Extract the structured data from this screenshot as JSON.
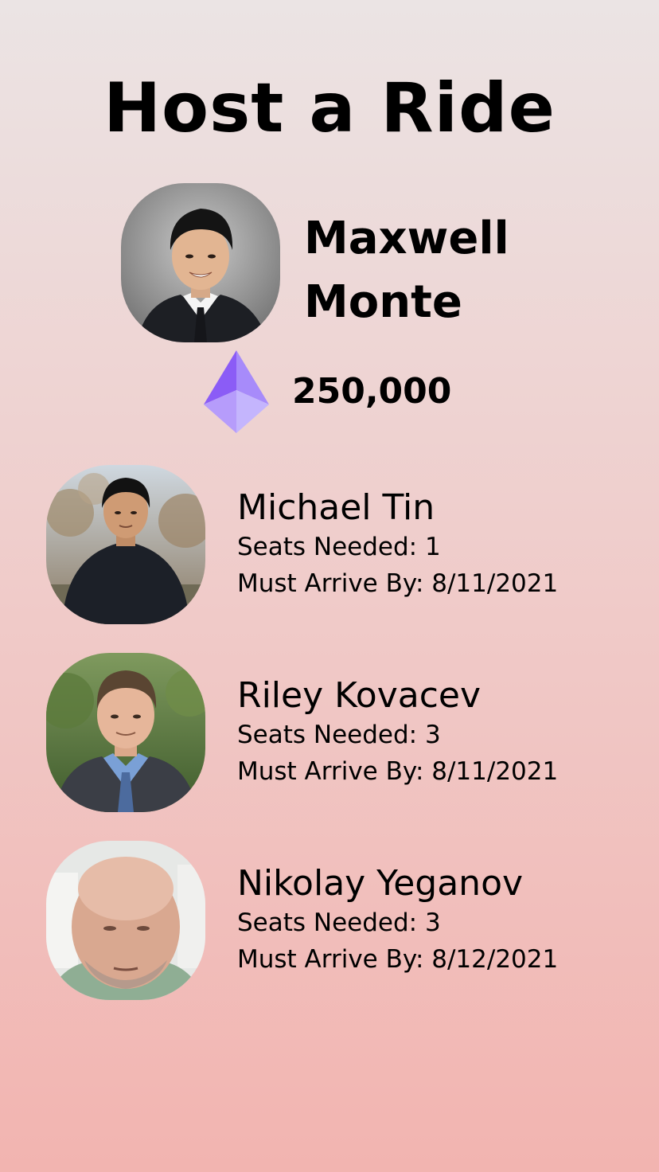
{
  "header": {
    "title": "Host a Ride"
  },
  "host": {
    "first_name": "Maxwell",
    "last_name": "Monte",
    "balance": "250,000",
    "token_icon": "ethereum-diamond-icon",
    "token_colors": [
      "#8b5cf6",
      "#a78bfa",
      "#c4b5fd"
    ]
  },
  "labels": {
    "seats": "Seats Needed:",
    "arrive": "Must Arrive By:"
  },
  "riders": [
    {
      "name": "Michael Tin",
      "seats": "1",
      "arrive": "8/11/2021"
    },
    {
      "name": "Riley Kovacev",
      "seats": "3",
      "arrive": "8/11/2021"
    },
    {
      "name": "Nikolay Yeganov",
      "seats": "3",
      "arrive": "8/12/2021"
    }
  ]
}
